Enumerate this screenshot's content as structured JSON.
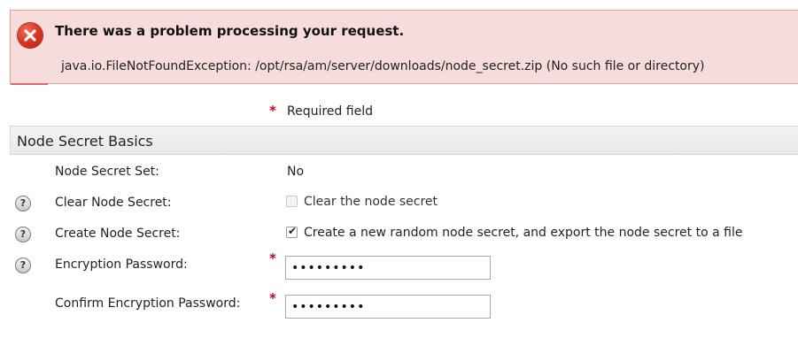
{
  "error": {
    "title": "There was a problem processing your request.",
    "message": "java.io.FileNotFoundException: /opt/rsa/am/server/downloads/node_secret.zip (No such file or directory)",
    "icon": "error-x-icon"
  },
  "required_legend": {
    "star": "*",
    "text": "Required field"
  },
  "section": {
    "title": "Node Secret Basics"
  },
  "fields": {
    "node_secret_set": {
      "label": "Node Secret Set:",
      "value": "No"
    },
    "clear_node_secret": {
      "label": "Clear Node Secret:",
      "checkbox_label": "Clear the node secret",
      "checked": false,
      "disabled": true
    },
    "create_node_secret": {
      "label": "Create Node Secret:",
      "checkbox_label": "Create a new random node secret, and export the node secret to a file",
      "checked": true
    },
    "encryption_password": {
      "label": "Encryption Password:",
      "value": "•••••••••",
      "required": "*"
    },
    "confirm_encryption_password": {
      "label": "Confirm Encryption Password:",
      "value": "•••••••••",
      "required": "*"
    }
  },
  "help_icon_glyph": "?",
  "colors": {
    "error_bg": "#f7dcdc",
    "error_border": "#e0a0a0",
    "required": "#d0021b"
  }
}
